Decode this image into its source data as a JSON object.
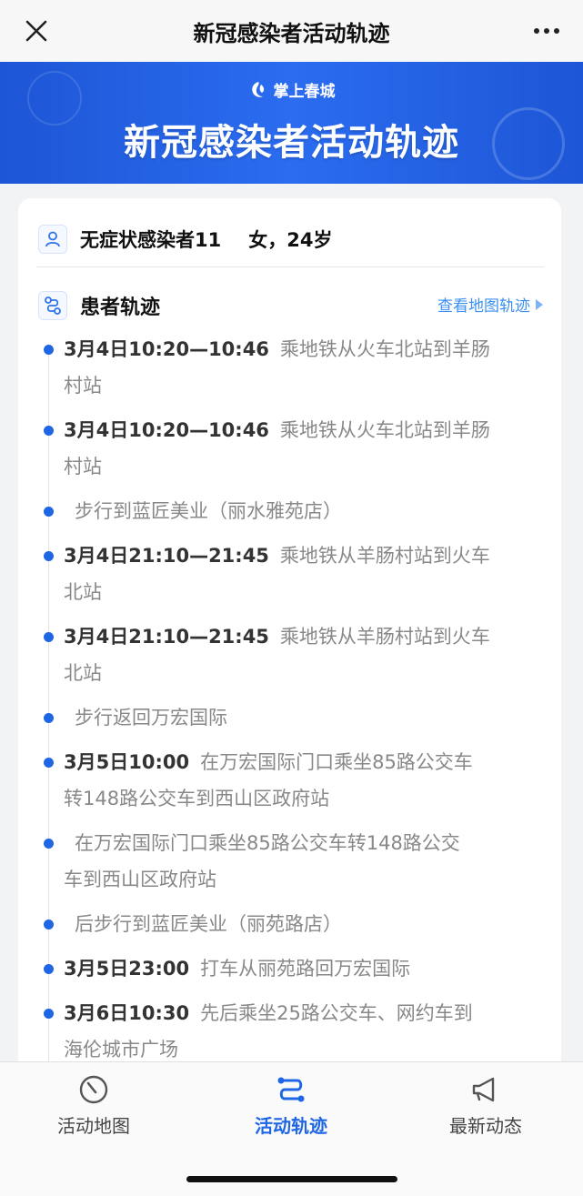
{
  "nav": {
    "title": "新冠感染者活动轨迹"
  },
  "banner": {
    "logo_text": "掌上春城",
    "title": "新冠感染者活动轨迹"
  },
  "patient": {
    "name": "无症状感染者11",
    "info": "女，24岁"
  },
  "section": {
    "title": "患者轨迹",
    "map_link": "查看地图轨迹"
  },
  "timeline": [
    {
      "time": "3月4日10:20—10:46",
      "lines": [
        "乘地铁从火车北站到羊肠",
        "村站"
      ]
    },
    {
      "time": "3月4日10:20—10:46",
      "lines": [
        "乘地铁从火车北站到羊肠",
        "村站"
      ]
    },
    {
      "time": "",
      "lines": [
        "步行到蓝匠美业（丽水雅苑店）"
      ]
    },
    {
      "time": "3月4日21:10—21:45",
      "lines": [
        "乘地铁从羊肠村站到火车",
        "北站"
      ]
    },
    {
      "time": "3月4日21:10—21:45",
      "lines": [
        "乘地铁从羊肠村站到火车",
        "北站"
      ]
    },
    {
      "time": "",
      "lines": [
        "步行返回万宏国际"
      ]
    },
    {
      "time": "3月5日10:00",
      "lines": [
        "在万宏国际门口乘坐85路公交车",
        "转148路公交车到西山区政府站"
      ]
    },
    {
      "time": "",
      "lines": [
        "在万宏国际门口乘坐85路公交车转148路公交",
        "车到西山区政府站"
      ]
    },
    {
      "time": "",
      "lines": [
        "后步行到蓝匠美业（丽苑路店）"
      ]
    },
    {
      "time": "3月5日23:00",
      "lines": [
        "打车从丽苑路回万宏国际"
      ]
    },
    {
      "time": "3月6日10:30",
      "lines": [
        "先后乘坐25路公交车、网约车到",
        "海伦城市广场"
      ]
    }
  ],
  "tabs": [
    {
      "label": "活动地图",
      "icon": "dial-icon",
      "active": false
    },
    {
      "label": "活动轨迹",
      "icon": "track-icon",
      "active": true
    },
    {
      "label": "最新动态",
      "icon": "megaphone-icon",
      "active": false
    }
  ],
  "colors": {
    "accent": "#1f66e5",
    "link": "#3b8ff0",
    "banner": "#2b6cf0"
  }
}
